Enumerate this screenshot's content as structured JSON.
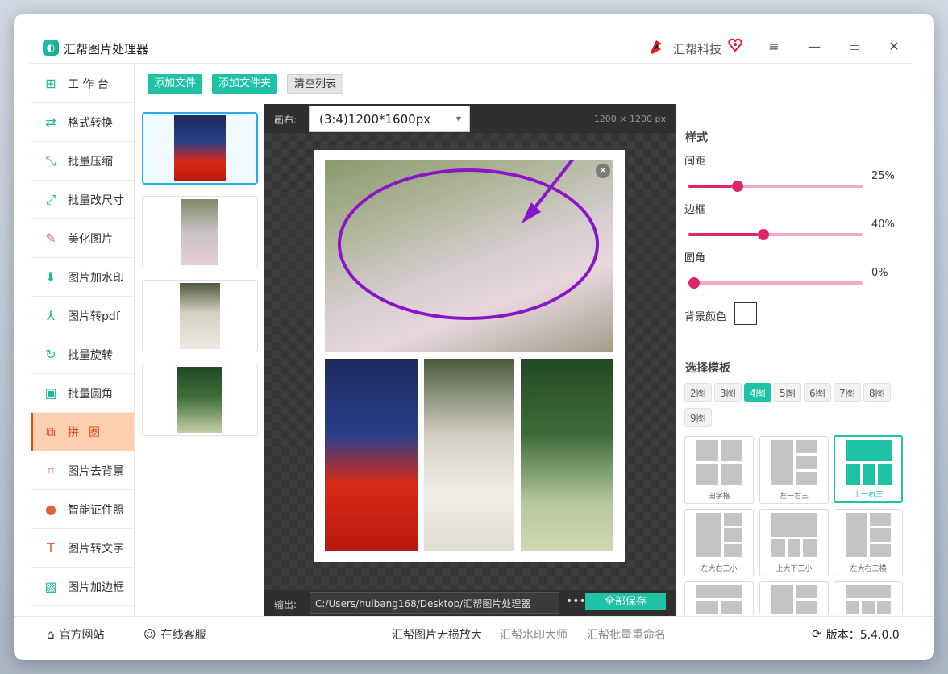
{
  "app": {
    "title": "汇帮图片处理器",
    "brand": "汇帮科技"
  },
  "sidebar": {
    "items": [
      {
        "label": "工 作 台",
        "icon": "grid-icon"
      },
      {
        "label": "格式转换",
        "icon": "format-convert-icon"
      },
      {
        "label": "批量压缩",
        "icon": "compress-icon"
      },
      {
        "label": "批量改尺寸",
        "icon": "resize-icon"
      },
      {
        "label": "美化图片",
        "icon": "beautify-icon"
      },
      {
        "label": "图片加水印",
        "icon": "watermark-icon"
      },
      {
        "label": "图片转pdf",
        "icon": "pdf-icon"
      },
      {
        "label": "批量旋转",
        "icon": "rotate-icon"
      },
      {
        "label": "批量圆角",
        "icon": "rounded-corner-icon"
      },
      {
        "label": "拼图",
        "icon": "puzzle-icon",
        "active": true
      },
      {
        "label": "图片去背景",
        "icon": "crop-icon"
      },
      {
        "label": "智能证件照",
        "icon": "person-icon"
      },
      {
        "label": "图片转文字",
        "icon": "text-icon"
      },
      {
        "label": "图片加边框",
        "icon": "frame-icon"
      }
    ]
  },
  "toolbar": {
    "add_file": "添加文件",
    "add_folder": "添加文件夹",
    "clear_list": "清空列表"
  },
  "canvas": {
    "label": "画布:",
    "selected": "(3:4)1200*1600px",
    "dimensions": "1200 × 1200 px",
    "output_label": "输出:",
    "output_path": "C:/Users/huibang168/Desktop/汇帮图片处理器",
    "more": "•••",
    "save_all": "全部保存"
  },
  "style": {
    "title": "样式",
    "spacing": {
      "label": "间距",
      "value": "25%",
      "fraction": 0.25
    },
    "border": {
      "label": "边框",
      "value": "40%",
      "fraction": 0.4
    },
    "radius": {
      "label": "圆角",
      "value": "0%",
      "fraction": 0.0
    },
    "bg_color_label": "背景颜色",
    "bg_color": "#ffffff"
  },
  "templates": {
    "title": "选择模板",
    "counts": [
      "2图",
      "3图",
      "4图",
      "5图",
      "6图",
      "7图",
      "8图",
      "9图"
    ],
    "selected_count": "4图",
    "cards": [
      {
        "name": "田字格"
      },
      {
        "name": "左一右三"
      },
      {
        "name": "上一右三",
        "selected": true
      },
      {
        "name": "左大右三小"
      },
      {
        "name": "上大下三小"
      },
      {
        "name": "左大右三横"
      }
    ]
  },
  "footer": {
    "website": "官方网站",
    "support": "在线客服",
    "link1": "汇帮图片无损放大",
    "link2": "汇帮水印大师",
    "link3": "汇帮批量重命名",
    "version": "版本：5.4.0.0"
  },
  "colors": {
    "accent": "#1ec3a6",
    "active": "#e24a1a",
    "slider": "#e0246a"
  }
}
